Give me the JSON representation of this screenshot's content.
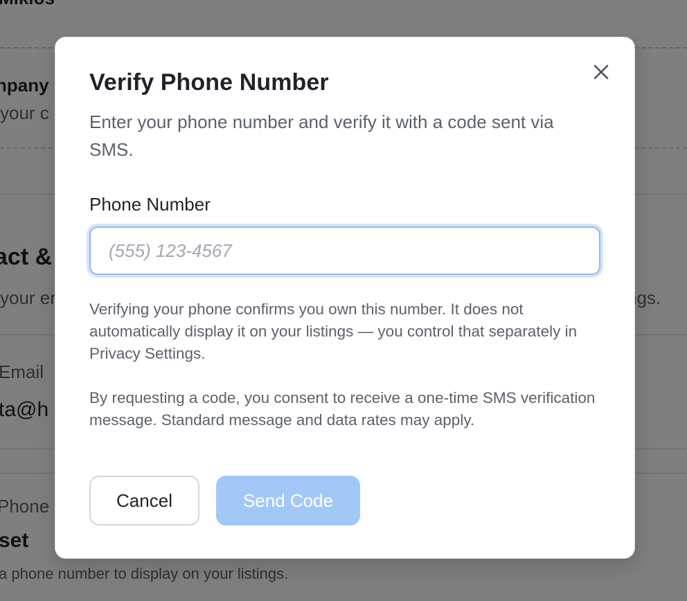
{
  "background": {
    "owner_name_fragment": "Mikios",
    "company_label_fragment": "npany",
    "company_desc_fragment": "your c",
    "contact_title_fragment": "act &",
    "contact_desc_fragment": "your er",
    "contact_desc_tail_fragment": "ngs.",
    "email_label_fragment": "Email",
    "email_value_fragment": "ta@h",
    "phone_label_fragment": "Phone",
    "phone_value_fragment": "set",
    "phone_hint_fragment": "a phone number to display on your listings."
  },
  "modal": {
    "title": "Verify Phone Number",
    "description": "Enter your phone number and verify it with a code sent via SMS.",
    "close_icon": "close-icon",
    "phone_field": {
      "label": "Phone Number",
      "placeholder": "(555) 123-4567",
      "value": ""
    },
    "info_text": "Verifying your phone confirms you own this number. It does not automatically display it on your listings — you control that separately in Privacy Settings.",
    "consent_text": "By requesting a code, you consent to receive a one-time SMS verification message. Standard message and data rates may apply.",
    "buttons": {
      "cancel_label": "Cancel",
      "send_label": "Send Code"
    }
  },
  "colors": {
    "overlay": "#00000080",
    "primary_disabled": "#a3c8f7",
    "focus_ring": "#8fb8ec"
  }
}
